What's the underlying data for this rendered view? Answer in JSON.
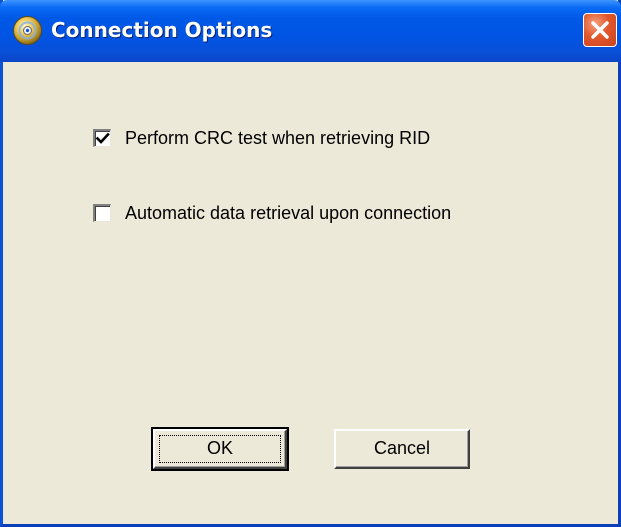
{
  "window": {
    "title": "Connection Options",
    "icon": "cd-disc-icon",
    "close_icon": "close-icon"
  },
  "options": {
    "crc_test": {
      "label": "Perform CRC test when retrieving RID",
      "checked": true
    },
    "auto_retrieval": {
      "label": "Automatic data retrieval upon connection",
      "checked": false
    }
  },
  "buttons": {
    "ok_label": "OK",
    "cancel_label": "Cancel"
  },
  "colors": {
    "titlebar": "#0054e3",
    "dialog_face": "#ece9d8",
    "close_button": "#e2562c"
  }
}
